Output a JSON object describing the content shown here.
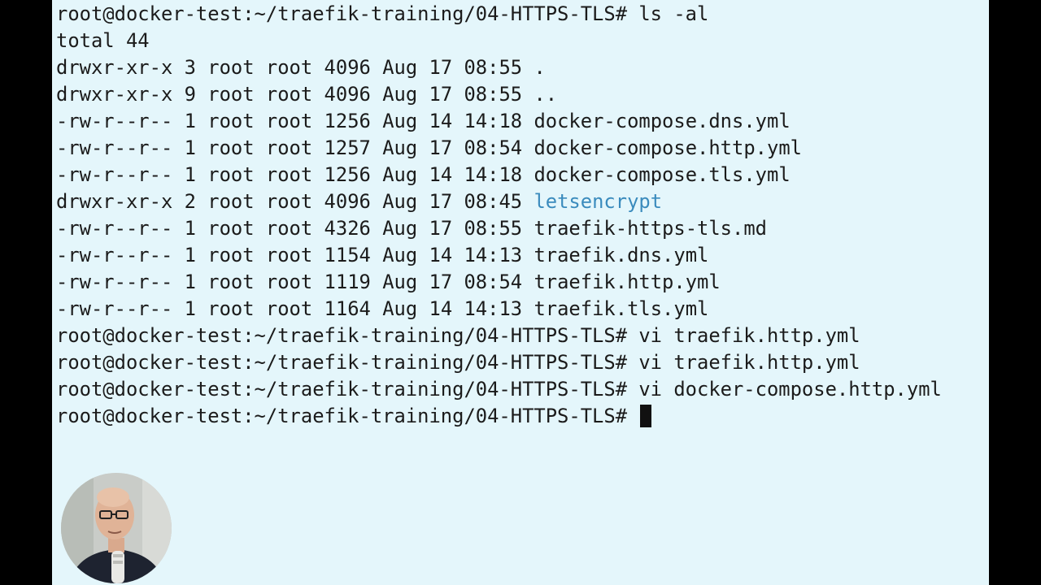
{
  "terminal": {
    "prompt": "root@docker-test:~/traefik-training/04-HTTPS-TLS# ",
    "lines": [
      {
        "type": "command",
        "text": "ls -al"
      },
      {
        "type": "output",
        "text": "total 44"
      },
      {
        "type": "entry",
        "perms": "drwxr-xr-x",
        "links": "3",
        "owner": "root",
        "group": "root",
        "size": "4096",
        "date": "Aug 17 08:55",
        "name": ".",
        "is_dir": false
      },
      {
        "type": "entry",
        "perms": "drwxr-xr-x",
        "links": "9",
        "owner": "root",
        "group": "root",
        "size": "4096",
        "date": "Aug 17 08:55",
        "name": "..",
        "is_dir": false
      },
      {
        "type": "entry",
        "perms": "-rw-r--r--",
        "links": "1",
        "owner": "root",
        "group": "root",
        "size": "1256",
        "date": "Aug 14 14:18",
        "name": "docker-compose.dns.yml",
        "is_dir": false
      },
      {
        "type": "entry",
        "perms": "-rw-r--r--",
        "links": "1",
        "owner": "root",
        "group": "root",
        "size": "1257",
        "date": "Aug 17 08:54",
        "name": "docker-compose.http.yml",
        "is_dir": false
      },
      {
        "type": "entry",
        "perms": "-rw-r--r--",
        "links": "1",
        "owner": "root",
        "group": "root",
        "size": "1256",
        "date": "Aug 14 14:18",
        "name": "docker-compose.tls.yml",
        "is_dir": false
      },
      {
        "type": "entry",
        "perms": "drwxr-xr-x",
        "links": "2",
        "owner": "root",
        "group": "root",
        "size": "4096",
        "date": "Aug 17 08:45",
        "name": "letsencrypt",
        "is_dir": true
      },
      {
        "type": "entry",
        "perms": "-rw-r--r--",
        "links": "1",
        "owner": "root",
        "group": "root",
        "size": "4326",
        "date": "Aug 17 08:55",
        "name": "traefik-https-tls.md",
        "is_dir": false
      },
      {
        "type": "entry",
        "perms": "-rw-r--r--",
        "links": "1",
        "owner": "root",
        "group": "root",
        "size": "1154",
        "date": "Aug 14 14:13",
        "name": "traefik.dns.yml",
        "is_dir": false
      },
      {
        "type": "entry",
        "perms": "-rw-r--r--",
        "links": "1",
        "owner": "root",
        "group": "root",
        "size": "1119",
        "date": "Aug 17 08:54",
        "name": "traefik.http.yml",
        "is_dir": false
      },
      {
        "type": "entry",
        "perms": "-rw-r--r--",
        "links": "1",
        "owner": "root",
        "group": "root",
        "size": "1164",
        "date": "Aug 14 14:13",
        "name": "traefik.tls.yml",
        "is_dir": false
      },
      {
        "type": "command",
        "text": "vi traefik.http.yml"
      },
      {
        "type": "command",
        "text": "vi traefik.http.yml"
      },
      {
        "type": "command",
        "text": "vi docker-compose.http.yml"
      },
      {
        "type": "command",
        "text": "",
        "cursor": true
      }
    ]
  },
  "colors": {
    "background": "#e4f6fb",
    "text": "#1b1b1b",
    "directory": "#3a8bbd",
    "letterbox": "#000000"
  }
}
